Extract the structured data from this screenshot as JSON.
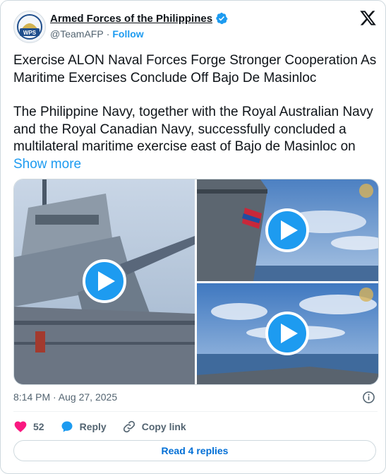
{
  "author": {
    "name": "Armed Forces of the Philippines",
    "handle": "@TeamAFP",
    "separator": "·",
    "follow_label": "Follow",
    "avatar_text": "WPS",
    "verified_icon": "verified-badge-icon"
  },
  "tweet": {
    "headline": "Exercise ALON Naval Forces Forge Stronger Cooperation As Maritime Exercises Conclude Off Bajo De Masinloc",
    "body": "The Philippine Navy, together with the Royal Australian Navy and the Royal Canadian Navy, successfully concluded a multilateral maritime exercise east of Bajo de Masinloc on ",
    "show_more": "Show more"
  },
  "media": {
    "videos": [
      {
        "name": "video-ship-gun",
        "icon": "play-icon"
      },
      {
        "name": "video-ship-flag",
        "icon": "play-icon"
      },
      {
        "name": "video-sea-horizon",
        "icon": "play-icon"
      }
    ]
  },
  "meta": {
    "timestamp": "8:14 PM · Aug 27, 2025"
  },
  "actions": {
    "like_count": "52",
    "reply_label": "Reply",
    "copy_label": "Copy link"
  },
  "footer": {
    "read_replies": "Read 4 replies"
  },
  "colors": {
    "accent": "#1d9bf0",
    "like": "#f91880",
    "link_button": "#006fd6",
    "muted": "#536471"
  }
}
